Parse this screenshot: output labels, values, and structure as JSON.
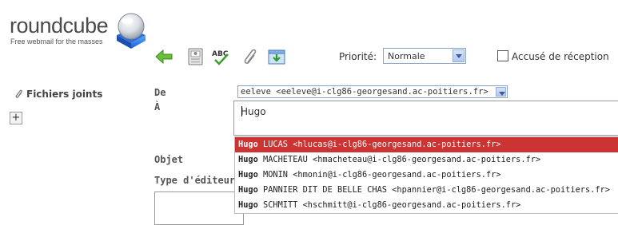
{
  "logo": {
    "name": "roundcube",
    "tagline": "Free webmail for the masses"
  },
  "toolbar": {
    "icons": [
      "back-arrow-icon",
      "address-book-icon",
      "spellcheck-icon",
      "paperclip-icon",
      "save-draft-icon"
    ],
    "priority_label": "Priorité:",
    "priority_value": "Normale",
    "receipt_label": "Accusé de réception"
  },
  "sidebar": {
    "attachments_label": "Fichiers joints",
    "add_button": "+"
  },
  "form": {
    "from_label": "De",
    "from_value": "eeleve <eeleve@i-clg86-georgesand.ac-poitiers.fr>",
    "to_label": "À",
    "to_value": "Hugo",
    "subject_label": "Objet",
    "editor_type_label": "Type d'éditeur"
  },
  "autocomplete": [
    {
      "match": "Hugo",
      "rest": " LUCAS <hlucas@i-clg86-georgesand.ac-poitiers.fr>",
      "selected": true
    },
    {
      "match": "Hugo",
      "rest": " MACHETEAU <hmacheteau@i-clg86-georgesand.ac-poitiers.fr>",
      "selected": false
    },
    {
      "match": "Hugo",
      "rest": " MONIN <hmonin@i-clg86-georgesand.ac-poitiers.fr>",
      "selected": false
    },
    {
      "match": "Hugo",
      "rest": " PANNIER DIT DE BELLE CHAS <hpannier@i-clg86-georgesand.ac-poitiers.fr>",
      "selected": false
    },
    {
      "match": "Hugo",
      "rest": " SCHMITT <hschmitt@i-clg86-georgesand.ac-poitiers.fr>",
      "selected": false
    }
  ],
  "colors": {
    "selection": "#cc3333",
    "select_border": "#8aa4c8"
  }
}
